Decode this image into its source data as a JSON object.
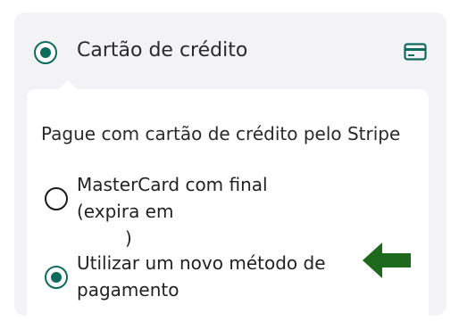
{
  "payment_method": {
    "label": "Cartão de crédito",
    "icon": "credit-card-icon",
    "accent_color": "#0f6b5a"
  },
  "stripe_panel": {
    "description": "Pague com cartão de crédito pelo Stripe",
    "saved_card": {
      "label_start": "MasterCard com final",
      "label_expiry": "(expira em",
      "label_close": ")"
    },
    "new_method": {
      "label": "Utilizar um novo método de pagamento"
    }
  },
  "annotation": {
    "arrow_color": "#1d6a1d"
  }
}
